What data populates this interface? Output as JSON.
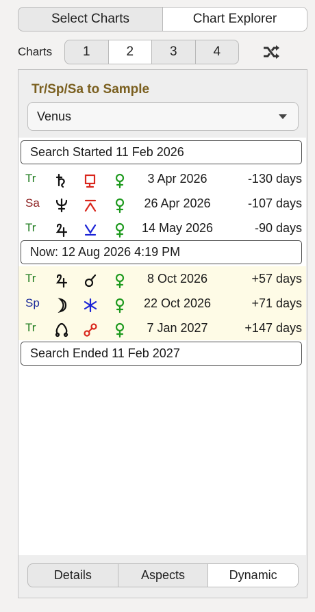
{
  "top_tabs": [
    {
      "label": "Select Charts",
      "active": false
    },
    {
      "label": "Chart Explorer",
      "active": true
    }
  ],
  "charts": {
    "label": "Charts",
    "numbers": [
      {
        "label": "1",
        "active": false
      },
      {
        "label": "2",
        "active": true
      },
      {
        "label": "3",
        "active": false
      },
      {
        "label": "4",
        "active": false
      }
    ],
    "shuffle_icon": "shuffle-icon"
  },
  "panel": {
    "title": "Tr/Sp/Sa to Sample",
    "dropdown_value": "Venus"
  },
  "markers": {
    "start": "Search Started 11 Feb 2026",
    "now": "Now: 12 Aug 2026 4:19 PM",
    "end": "Search Ended 11 Feb 2027"
  },
  "past_rows": [
    {
      "who": "Tr",
      "who_color": "#1b7a1b",
      "planet": "saturn",
      "aspect": "square",
      "aspect_color": "#d9261c",
      "target": "venus",
      "date": "3 Apr 2026",
      "days": "-130 days"
    },
    {
      "who": "Sa",
      "who_color": "#8a1c1c",
      "planet": "neptune",
      "aspect": "sesquiquadrate",
      "aspect_color": "#d9261c",
      "target": "venus",
      "date": "26 Apr 2026",
      "days": "-107 days"
    },
    {
      "who": "Tr",
      "who_color": "#1b7a1b",
      "planet": "jupiter",
      "aspect": "semisextile",
      "aspect_color": "#1a23d6",
      "target": "venus",
      "date": "14 May 2026",
      "days": "-90 days"
    }
  ],
  "future_rows": [
    {
      "who": "Tr",
      "who_color": "#1b7a1b",
      "planet": "jupiter",
      "aspect": "conjunction",
      "aspect_color": "#111111",
      "target": "venus",
      "date": "8 Oct 2026",
      "days": "+57 days"
    },
    {
      "who": "Sp",
      "who_color": "#1a2a9a",
      "planet": "moon",
      "aspect": "sextile",
      "aspect_color": "#1a23d6",
      "target": "venus",
      "date": "22 Oct 2026",
      "days": "+71 days"
    },
    {
      "who": "Tr",
      "who_color": "#1b7a1b",
      "planet": "node",
      "aspect": "opposition",
      "aspect_color": "#d9261c",
      "target": "venus",
      "date": "7 Jan 2027",
      "days": "+147 days"
    }
  ],
  "bottom_tabs": [
    {
      "label": "Details",
      "active": false
    },
    {
      "label": "Aspects",
      "active": false
    },
    {
      "label": "Dynamic",
      "active": true
    }
  ],
  "colors": {
    "accent_title": "#7a5f1f",
    "venus_green": "#1f9a1f",
    "future_bg": "#fefbe6"
  }
}
